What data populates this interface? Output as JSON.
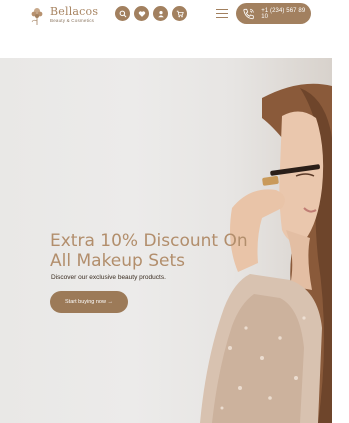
{
  "header": {
    "brand_name": "Bellacos",
    "brand_tagline": "Beauty & Cosmetics",
    "icons": [
      "search-icon",
      "heart-icon",
      "user-icon",
      "cart-icon"
    ],
    "menu_icon": "hamburger-icon",
    "phone": "+1 (234) 567 89 10"
  },
  "hero": {
    "title": "Extra 10% Discount On All Makeup Sets",
    "subtitle": "Discover our exclusive beauty products.",
    "cta_label": "Start buying now →"
  },
  "colors": {
    "accent": "#a2805f",
    "title": "#b28e6c",
    "button": "#9c7a58",
    "hero_bg": "#e9e8e6"
  }
}
